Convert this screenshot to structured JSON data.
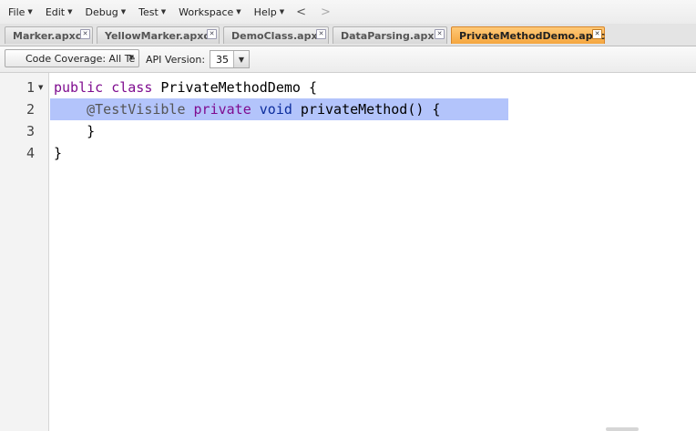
{
  "menu": {
    "items": [
      {
        "label": "File"
      },
      {
        "label": "Edit"
      },
      {
        "label": "Debug"
      },
      {
        "label": "Test"
      },
      {
        "label": "Workspace"
      },
      {
        "label": "Help"
      }
    ],
    "back_label": "<",
    "forward_label": ">"
  },
  "tabs": [
    {
      "label": "Marker.apxc",
      "active": false
    },
    {
      "label": "YellowMarker.apxc",
      "active": false
    },
    {
      "label": "DemoClass.apxc",
      "active": false
    },
    {
      "label": "DataParsing.apxc",
      "active": false
    },
    {
      "label": "PrivateMethodDemo.apxc",
      "active": true
    }
  ],
  "toolbar": {
    "coverage_label": "Code Coverage: All Te",
    "api_label": "API Version:",
    "api_value": "35"
  },
  "editor": {
    "lines": [
      {
        "num": "1",
        "tokens": [
          {
            "t": "public",
            "c": "kw"
          },
          {
            "t": " "
          },
          {
            "t": "class",
            "c": "kw"
          },
          {
            "t": " PrivateMethodDemo {"
          }
        ]
      },
      {
        "num": "2",
        "tokens": [
          {
            "t": "    "
          },
          {
            "t": "@TestVisible",
            "c": "anno"
          },
          {
            "t": " "
          },
          {
            "t": "private",
            "c": "kw"
          },
          {
            "t": " "
          },
          {
            "t": "void",
            "c": "kw2"
          },
          {
            "t": " privateMethod() {"
          }
        ]
      },
      {
        "num": "3",
        "tokens": [
          {
            "t": "    }"
          }
        ]
      },
      {
        "num": "4",
        "tokens": [
          {
            "t": "}"
          }
        ]
      }
    ]
  },
  "colors": {
    "active_tab": "#f5a63f",
    "line_highlight": "#b3c4fb",
    "keyword": "#7f0c8f"
  }
}
